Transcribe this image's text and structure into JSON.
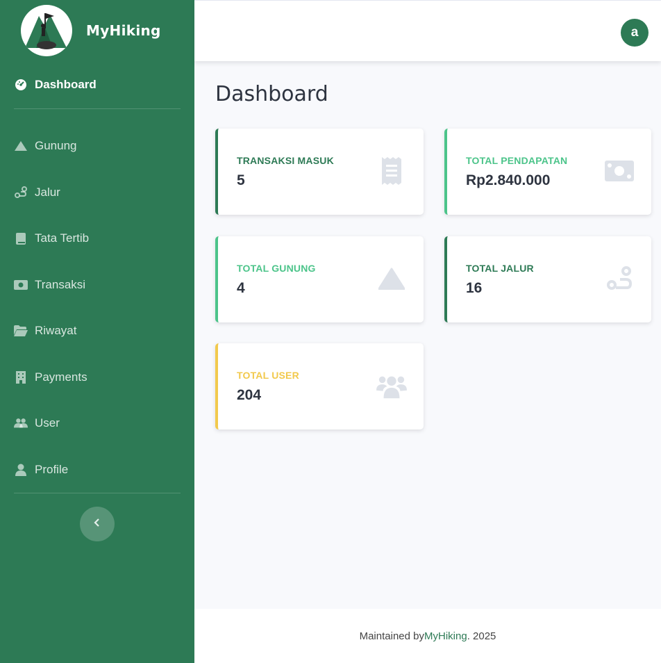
{
  "brand": {
    "name": "MyHiking"
  },
  "sidebar": {
    "active": {
      "label": "Dashboard",
      "icon": "tachometer-icon"
    },
    "items": [
      {
        "label": "Gunung",
        "icon": "mountain-icon"
      },
      {
        "label": "Jalur",
        "icon": "route-icon"
      },
      {
        "label": "Tata Tertib",
        "icon": "book-icon"
      },
      {
        "label": "Transaksi",
        "icon": "money-icon"
      },
      {
        "label": "Riwayat",
        "icon": "folder-open-icon"
      },
      {
        "label": "Payments",
        "icon": "building-icon"
      },
      {
        "label": "User",
        "icon": "users-icon"
      },
      {
        "label": "Profile",
        "icon": "user-icon"
      }
    ],
    "toggle_icon": "chevron-left-icon"
  },
  "topbar": {
    "avatar_initial": "a"
  },
  "page": {
    "title": "Dashboard"
  },
  "cards": [
    {
      "label": "TRANSAKSI MASUK",
      "value": "5",
      "icon": "receipt-icon",
      "accent": "#2d7a55"
    },
    {
      "label": "TOTAL PENDAPATAN",
      "value": "Rp2.840.000",
      "icon": "money-bill-icon",
      "accent": "#4cc48a"
    },
    {
      "label": "TOTAL GUNUNG",
      "value": "4",
      "icon": "mountain-icon",
      "accent": "#4cc48a"
    },
    {
      "label": "TOTAL JALUR",
      "value": "16",
      "icon": "route-icon",
      "accent": "#2d7a55"
    },
    {
      "label": "TOTAL USER",
      "value": "204",
      "icon": "users-icon",
      "accent": "#f2c94c"
    }
  ],
  "footer": {
    "prefix": "Maintained by ",
    "brand": "MyHiking",
    "suffix": ". 2025"
  },
  "colors": {
    "sidebar": "#2d7a55",
    "accent_light": "#4cc48a",
    "warning": "#f2c94c",
    "icon_muted": "#dde1e8"
  }
}
